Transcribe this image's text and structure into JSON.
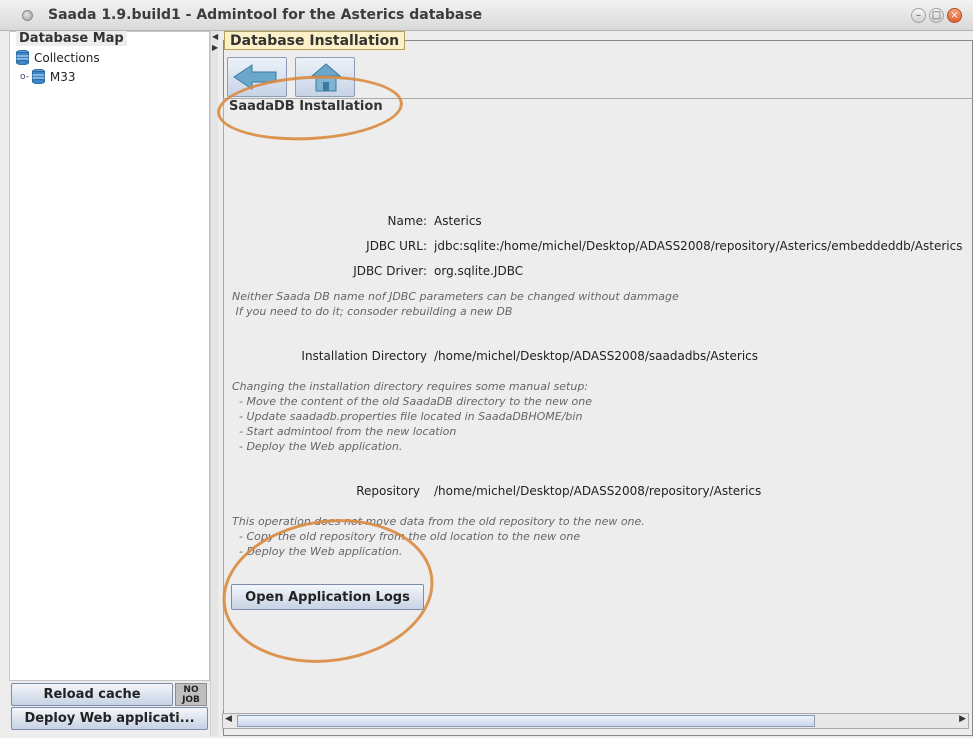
{
  "window": {
    "title": "Saada 1.9.build1 - Admintool for the Asterics database",
    "minimize_icon": "minimize-icon",
    "maximize_icon": "maximize-icon",
    "close_icon": "close-icon"
  },
  "sidebar": {
    "legend": "Database Map",
    "tree": [
      {
        "label": "Collections",
        "icon": "database-icon"
      },
      {
        "label": "M33",
        "icon": "database-icon"
      }
    ],
    "reload_button": "Reload cache",
    "job_badge": "NO JOB",
    "deploy_button": "Deploy Web applicati..."
  },
  "main": {
    "tab_label": "Database Installation",
    "toolbar_icons": [
      "back-icon",
      "home-icon"
    ],
    "section_legend": "SaadaDB Installation",
    "fields": {
      "name_label": "Name:",
      "name_value": "Asterics",
      "jdbc_url_label": "JDBC URL:",
      "jdbc_url_value": "jdbc:sqlite:/home/michel/Desktop/ADASS2008/repository/Asterics/embeddeddb/Asterics",
      "jdbc_driver_label": "JDBC Driver:",
      "jdbc_driver_value": "org.sqlite.JDBC",
      "install_dir_label": "Installation Directory",
      "install_dir_value": "/home/michel/Desktop/ADASS2008/saadadbs/Asterics",
      "repository_label": "Repository",
      "repository_value": "/home/michel/Desktop/ADASS2008/repository/Asterics"
    },
    "notes": {
      "db_note": "Neither Saada DB name nof JDBC parameters can be changed without dammage\n If you need to do it; consoder rebuilding a new DB",
      "install_note": "Changing the installation directory requires some manual setup:\n  - Move the content of the old SaadaDB directory to the new one\n  - Update saadadb.properties file located in SaadaDBHOME/bin\n  - Start admintool from the new location\n  - Deploy the Web application.",
      "repo_note": "This operation does not move data from the old repository to the new one.\n  - Copy the old repository from the old location to the new one\n  - Deploy the Web application."
    },
    "open_logs_button": "Open Application Logs"
  },
  "colors": {
    "accent": "#fcf0c8",
    "annotation": "#d9893f",
    "button_gradient_bottom": "#c6d2e4"
  }
}
